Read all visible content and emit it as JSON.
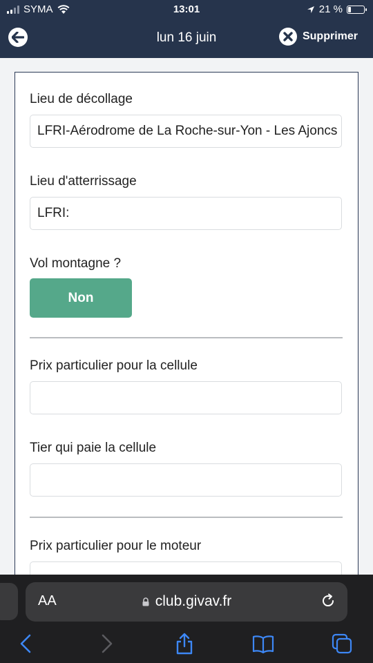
{
  "status": {
    "carrier": "SYMA",
    "time": "13:01",
    "battery": "21 %",
    "battery_level": 0.21
  },
  "header": {
    "title": "lun 16 juin",
    "delete_label": "Supprimer"
  },
  "form": {
    "takeoff_label": "Lieu de décollage",
    "takeoff_value": "LFRI-Aérodrome de La Roche-sur-Yon - Les Ajoncs",
    "landing_label": "Lieu d'atterrissage",
    "landing_value": "LFRI:",
    "mountain_label": "Vol montagne ?",
    "mountain_value": "Non",
    "cell_price_label": "Prix particulier pour la cellule",
    "cell_price_value": "",
    "cell_payer_label": "Tier qui paie la cellule",
    "cell_payer_value": "",
    "engine_price_label": "Prix particulier pour le moteur",
    "engine_price_value": ""
  },
  "browser": {
    "aa_label": "AA",
    "url": "club.givav.fr"
  },
  "colors": {
    "header_bg": "#26344c",
    "toggle_green": "#55a88a",
    "safari_bg": "#1f1f21"
  }
}
